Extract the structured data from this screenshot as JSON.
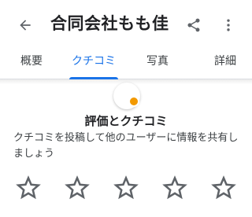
{
  "header": {
    "title": "合同会社もも佳"
  },
  "tabs": [
    {
      "label": "概要",
      "active": false
    },
    {
      "label": "クチコミ",
      "active": true
    },
    {
      "label": "写真",
      "active": false
    },
    {
      "label": "詳細",
      "active": false
    }
  ],
  "review_section": {
    "title": "評価とクチコミ",
    "description": "クチコミを投稿して他のユーザーに情報を共有しましょう",
    "rating": 0,
    "max_rating": 5
  },
  "icons": {
    "back": "arrow-back-icon",
    "share": "share-icon",
    "more": "more-vert-icon",
    "star": "star-outline-icon"
  },
  "colors": {
    "accent": "#1a73e8",
    "avatar_badge": "#f29900",
    "icon": "#5f6368"
  }
}
